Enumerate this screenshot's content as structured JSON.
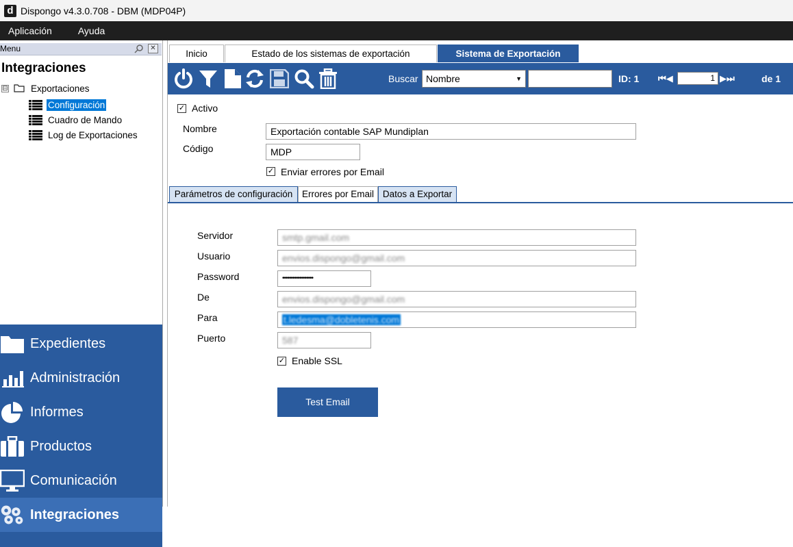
{
  "window": {
    "logo": "d",
    "title": "Dispongo v4.3.0.708 - DBM (MDP04P)"
  },
  "menubar": {
    "items": [
      "Aplicación",
      "Ayuda"
    ]
  },
  "menu_panel": {
    "header_label": "Menu",
    "section_title": "Integraciones",
    "tree": {
      "root": {
        "expander": "⊟",
        "label": "Exportaciones"
      },
      "children": [
        {
          "label": "Configuración",
          "selected": true
        },
        {
          "label": "Cuadro de Mando",
          "selected": false
        },
        {
          "label": "Log de Exportaciones",
          "selected": false
        }
      ]
    }
  },
  "nav": {
    "items": [
      {
        "label": "Expedientes",
        "icon": "folder-icon"
      },
      {
        "label": "Administración",
        "icon": "bar-chart-icon"
      },
      {
        "label": "Informes",
        "icon": "pie-chart-icon"
      },
      {
        "label": "Productos",
        "icon": "briefcase-icon"
      },
      {
        "label": "Comunicación",
        "icon": "monitor-icon"
      },
      {
        "label": "Integraciones",
        "icon": "puzzle-icon",
        "active": true
      }
    ]
  },
  "tabs": [
    {
      "label": "Inicio"
    },
    {
      "label": "Estado de los sistemas de exportación"
    },
    {
      "label": "Sistema de Exportación",
      "active": true
    }
  ],
  "toolbar": {
    "icons": [
      "power-icon",
      "filter-icon",
      "new-document-icon",
      "refresh-icon",
      "save-icon",
      "search-icon",
      "delete-icon"
    ],
    "buscar_label": "Buscar",
    "buscar_selected": "Nombre",
    "buscar_value": "",
    "id_label": "ID: 1",
    "page_value": "1",
    "de_label": "de 1"
  },
  "form": {
    "activo_label": "Activo",
    "activo_checked": true,
    "nombre_label": "Nombre",
    "nombre_value": "Exportación contable SAP Mundiplan",
    "codigo_label": "Código",
    "codigo_value": "MDP",
    "enviar_label": "Enviar errores por Email",
    "enviar_checked": true
  },
  "inner_tabs": [
    {
      "label": "Parámetros de configuración"
    },
    {
      "label": "Errores por Email",
      "active": true
    },
    {
      "label": "Datos a Exportar"
    }
  ],
  "email_settings": {
    "servidor_label": "Servidor",
    "servidor_value": "smtp.gmail.com",
    "usuario_label": "Usuario",
    "usuario_value": "envios.dispongo@gmail.com",
    "password_label": "Password",
    "password_value": "••••••••••••••••••",
    "de_label": "De",
    "de_value": "envios.dispongo@gmail.com",
    "para_label": "Para",
    "para_value": "t.ledesma@dobletenis.com",
    "puerto_label": "Puerto",
    "puerto_value": "587",
    "ssl_label": "Enable SSL",
    "ssl_checked": true,
    "test_button": "Test Email"
  }
}
